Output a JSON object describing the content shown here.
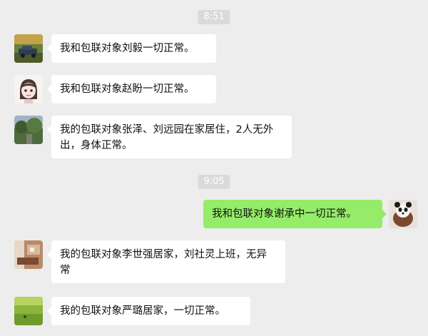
{
  "timestamps": [
    "8:51",
    "9:05"
  ],
  "messages": [
    {
      "sender": "other",
      "avatar": "car-photo",
      "text": "我和包联对象刘毅一切正常。"
    },
    {
      "sender": "other",
      "avatar": "cartoon-girl",
      "text": "我和包联对象赵盼一切正常。"
    },
    {
      "sender": "other",
      "avatar": "trees-photo",
      "text": "我的包联对象张泽、刘远园在家居住，2人无外出，身体正常。"
    },
    {
      "sender": "self",
      "avatar": "panda-photo",
      "text": "我和包联对象谢承中一切正常。"
    },
    {
      "sender": "other",
      "avatar": "room-photo",
      "text": "我的包联对象李世强居家，刘社灵上班，无异常"
    },
    {
      "sender": "other",
      "avatar": "grass-photo",
      "text": "我的包联对象严璐居家，一切正常。"
    }
  ],
  "colors": {
    "background": "#ededed",
    "self_bubble": "#95ec69",
    "other_bubble": "#ffffff"
  }
}
